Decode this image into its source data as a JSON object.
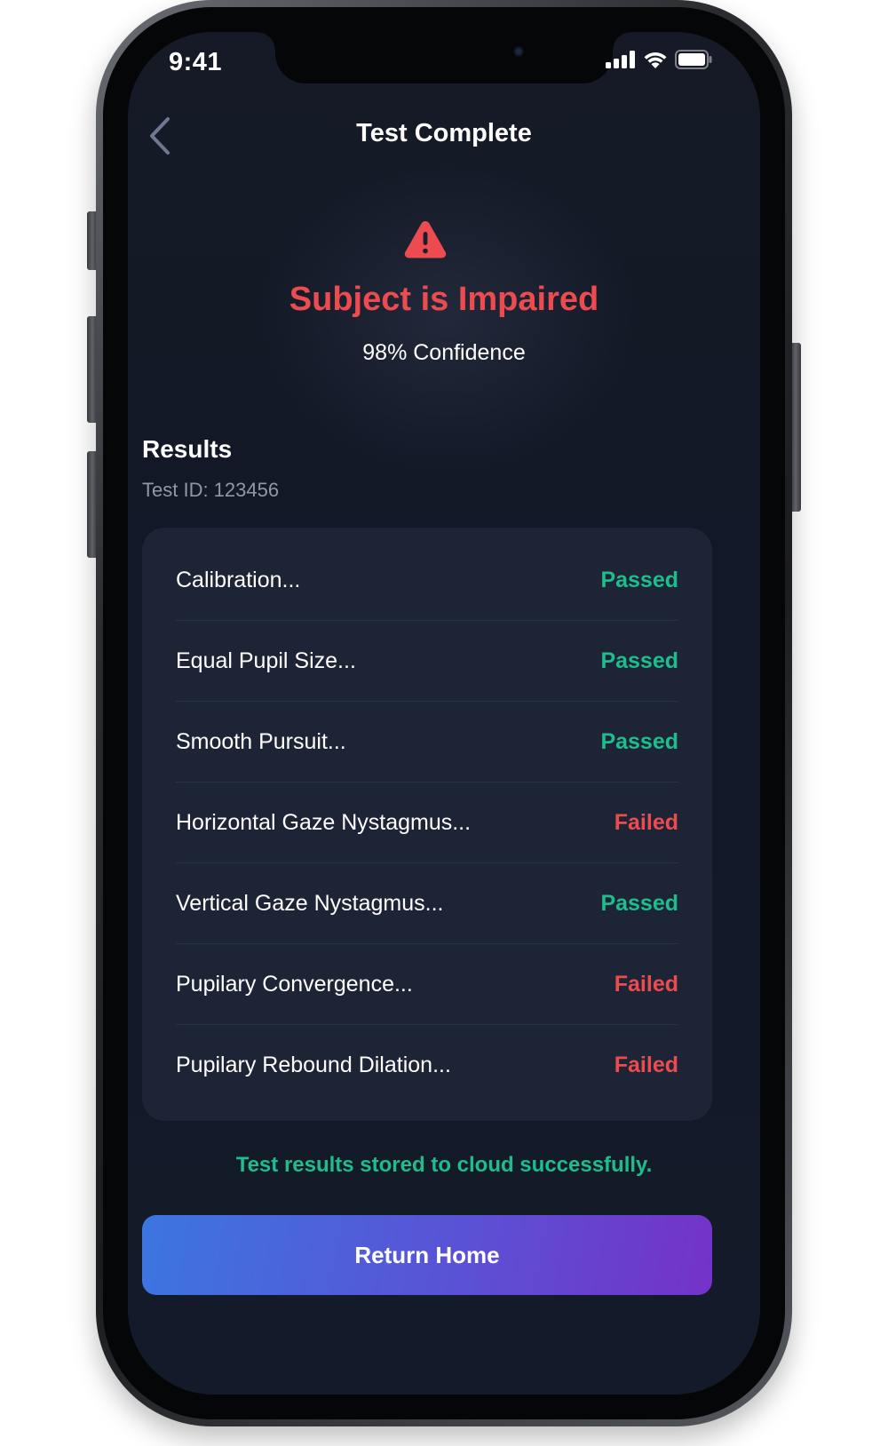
{
  "status_bar": {
    "time": "9:41"
  },
  "header": {
    "title": "Test Complete",
    "back_icon": "chevron-left-icon"
  },
  "verdict": {
    "icon": "warning-triangle-icon",
    "headline": "Subject is Impaired",
    "confidence": "98% Confidence"
  },
  "results": {
    "title": "Results",
    "test_id": "Test ID: 123456",
    "rows": [
      {
        "label": "Calibration...",
        "status": "Passed"
      },
      {
        "label": "Equal Pupil Size...",
        "status": "Passed"
      },
      {
        "label": "Smooth Pursuit...",
        "status": "Passed"
      },
      {
        "label": "Horizontal Gaze Nystagmus...",
        "status": "Failed"
      },
      {
        "label": "Vertical Gaze Nystagmus...",
        "status": "Passed"
      },
      {
        "label": "Pupilary Convergence...",
        "status": "Failed"
      },
      {
        "label": "Pupilary Rebound Dilation...",
        "status": "Failed"
      }
    ]
  },
  "footer": {
    "cloud_message": "Test results stored to cloud successfully.",
    "return_label": "Return Home"
  },
  "colors": {
    "background": "#131a29",
    "card": "#1d2435",
    "impaired_red": "#ec4b4f",
    "passed_green": "#1ebd8b",
    "button_gradient_start": "#3c76e0",
    "button_gradient_end": "#7432c8"
  }
}
